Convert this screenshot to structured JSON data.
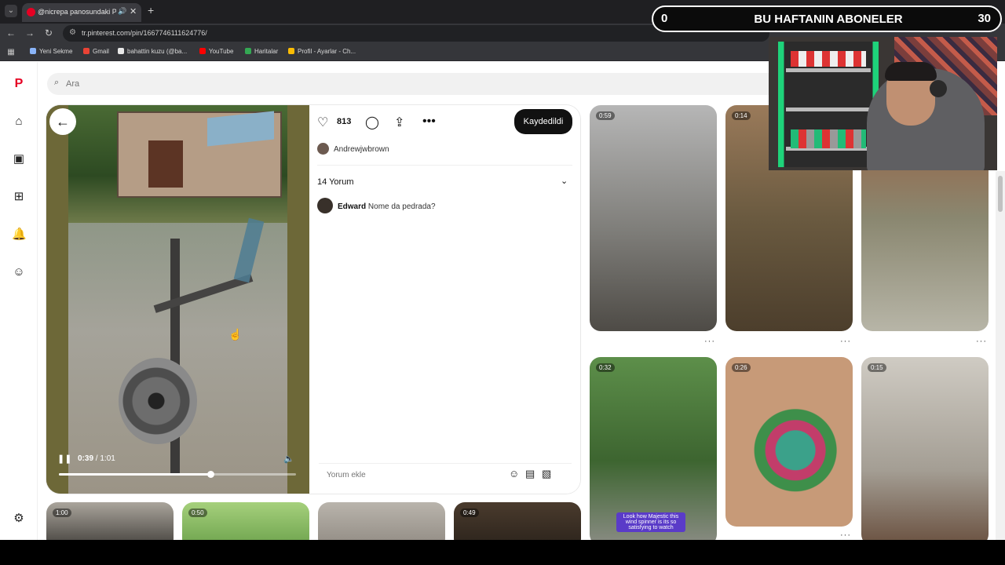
{
  "browser": {
    "tab_title": "@nicrepa panosundaki Pin",
    "tab_audio_icon": "speaker-icon",
    "tab_close": "✕",
    "new_tab": "+",
    "url": "tr.pinterest.com/pin/1667746111624776/",
    "bookmarks": [
      "Yeni Sekme",
      "Gmail",
      "bahattin kuzu (@ba...",
      "YouTube",
      "Haritalar",
      "Profil - Ayarlar - Ch..."
    ],
    "bookmark_colors": [
      "#8ab4f8",
      "#ea4335",
      "#e8e8e8",
      "#ff0000",
      "#34a853",
      "#fbbc04"
    ]
  },
  "search": {
    "placeholder": "Ara"
  },
  "video": {
    "time_current": "0:39",
    "time_total": "/ 1:01",
    "progress_fraction": 0.64
  },
  "detail": {
    "like_count": "813",
    "save_label": "Kaydedildi",
    "author": "Andrewjwbrown",
    "comments_title": "14 Yorum",
    "comment_user": "Edward",
    "comment_text": "Nome da pedrada?",
    "comment_placeholder": "Yorum ekle"
  },
  "grid": {
    "tiles": [
      {
        "duration": "0:59",
        "color": "#5b5b58"
      },
      {
        "duration": "0:14",
        "color": "#6a5a40"
      },
      {
        "duration": "",
        "color": "#8a8770"
      },
      {
        "duration": "0:32",
        "color": "#4a6d3a"
      },
      {
        "duration": "0:26",
        "color": "#6e6a62"
      },
      {
        "duration": "0:15",
        "color": "#a49e94"
      },
      {
        "duration": "1:00",
        "color": "#3f3c38"
      },
      {
        "duration": "0:50",
        "color": "#7cab5a"
      },
      {
        "duration": "",
        "color": "#9b958c"
      },
      {
        "duration": "0:49",
        "color": "#3d3126"
      }
    ],
    "caption": "Look how Majestic this wind spinner is its so satisfying to watch"
  },
  "overlay": {
    "left_count": "0",
    "title": "BU HAFTANIN ABONELER",
    "right_count": "30"
  }
}
